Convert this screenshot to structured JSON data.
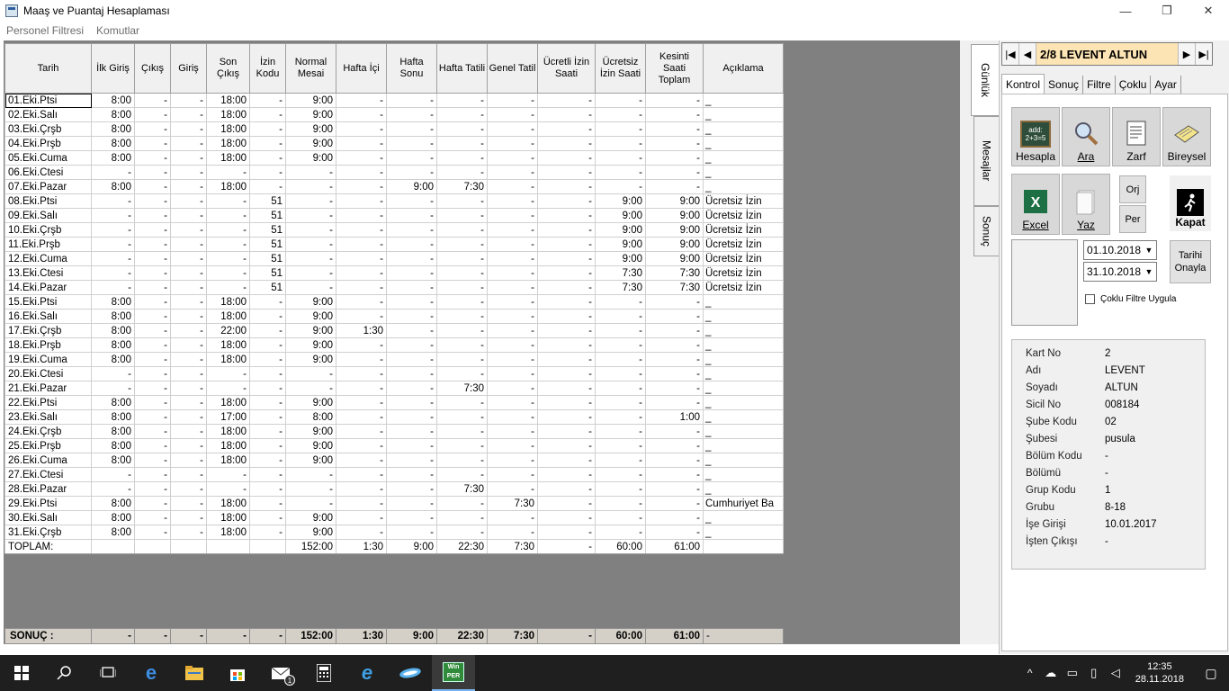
{
  "window": {
    "title": "Maaş ve Puantaj Hesaplaması",
    "minimize": "—",
    "restore": "❐",
    "close": "✕"
  },
  "menu": [
    "Personel Filtresi",
    "Komutlar"
  ],
  "grid": {
    "headers": [
      "Tarih",
      "İlk Giriş",
      "Çıkış",
      "Giriş",
      "Son Çıkış",
      "İzin Kodu",
      "Normal Mesai",
      "Hafta İçi",
      "Hafta Sonu",
      "Hafta Tatili",
      "Genel Tatil",
      "Ücretli İzin Saati",
      "Ücretsiz İzin Saati",
      "Kesinti Saati Toplam",
      "Açıklama"
    ],
    "rows": [
      [
        "01.Eki.Ptsi",
        "8:00",
        "-",
        "-",
        "18:00",
        "-",
        "9:00",
        "-",
        "-",
        "-",
        "-",
        "-",
        "-",
        "-",
        "_"
      ],
      [
        "02.Eki.Salı",
        "8:00",
        "-",
        "-",
        "18:00",
        "-",
        "9:00",
        "-",
        "-",
        "-",
        "-",
        "-",
        "-",
        "-",
        "_"
      ],
      [
        "03.Eki.Çrşb",
        "8:00",
        "-",
        "-",
        "18:00",
        "-",
        "9:00",
        "-",
        "-",
        "-",
        "-",
        "-",
        "-",
        "-",
        "_"
      ],
      [
        "04.Eki.Prşb",
        "8:00",
        "-",
        "-",
        "18:00",
        "-",
        "9:00",
        "-",
        "-",
        "-",
        "-",
        "-",
        "-",
        "-",
        "_"
      ],
      [
        "05.Eki.Cuma",
        "8:00",
        "-",
        "-",
        "18:00",
        "-",
        "9:00",
        "-",
        "-",
        "-",
        "-",
        "-",
        "-",
        "-",
        "_"
      ],
      [
        "06.Eki.Ctesi",
        "-",
        "-",
        "-",
        "-",
        "-",
        "-",
        "-",
        "-",
        "-",
        "-",
        "-",
        "-",
        "-",
        "_"
      ],
      [
        "07.Eki.Pazar",
        "8:00",
        "-",
        "-",
        "18:00",
        "-",
        "-",
        "-",
        "9:00",
        "7:30",
        "-",
        "-",
        "-",
        "-",
        "_"
      ],
      [
        "08.Eki.Ptsi",
        "-",
        "-",
        "-",
        "-",
        "51",
        "-",
        "-",
        "-",
        "-",
        "-",
        "-",
        "9:00",
        "9:00",
        "Ücretsiz İzin"
      ],
      [
        "09.Eki.Salı",
        "-",
        "-",
        "-",
        "-",
        "51",
        "-",
        "-",
        "-",
        "-",
        "-",
        "-",
        "9:00",
        "9:00",
        "Ücretsiz İzin"
      ],
      [
        "10.Eki.Çrşb",
        "-",
        "-",
        "-",
        "-",
        "51",
        "-",
        "-",
        "-",
        "-",
        "-",
        "-",
        "9:00",
        "9:00",
        "Ücretsiz İzin"
      ],
      [
        "11.Eki.Prşb",
        "-",
        "-",
        "-",
        "-",
        "51",
        "-",
        "-",
        "-",
        "-",
        "-",
        "-",
        "9:00",
        "9:00",
        "Ücretsiz İzin"
      ],
      [
        "12.Eki.Cuma",
        "-",
        "-",
        "-",
        "-",
        "51",
        "-",
        "-",
        "-",
        "-",
        "-",
        "-",
        "9:00",
        "9:00",
        "Ücretsiz İzin"
      ],
      [
        "13.Eki.Ctesi",
        "-",
        "-",
        "-",
        "-",
        "51",
        "-",
        "-",
        "-",
        "-",
        "-",
        "-",
        "7:30",
        "7:30",
        "Ücretsiz İzin"
      ],
      [
        "14.Eki.Pazar",
        "-",
        "-",
        "-",
        "-",
        "51",
        "-",
        "-",
        "-",
        "-",
        "-",
        "-",
        "7:30",
        "7:30",
        "Ücretsiz İzin"
      ],
      [
        "15.Eki.Ptsi",
        "8:00",
        "-",
        "-",
        "18:00",
        "-",
        "9:00",
        "-",
        "-",
        "-",
        "-",
        "-",
        "-",
        "-",
        "_"
      ],
      [
        "16.Eki.Salı",
        "8:00",
        "-",
        "-",
        "18:00",
        "-",
        "9:00",
        "-",
        "-",
        "-",
        "-",
        "-",
        "-",
        "-",
        "_"
      ],
      [
        "17.Eki.Çrşb",
        "8:00",
        "-",
        "-",
        "22:00",
        "-",
        "9:00",
        "1:30",
        "-",
        "-",
        "-",
        "-",
        "-",
        "-",
        "_"
      ],
      [
        "18.Eki.Prşb",
        "8:00",
        "-",
        "-",
        "18:00",
        "-",
        "9:00",
        "-",
        "-",
        "-",
        "-",
        "-",
        "-",
        "-",
        "_"
      ],
      [
        "19.Eki.Cuma",
        "8:00",
        "-",
        "-",
        "18:00",
        "-",
        "9:00",
        "-",
        "-",
        "-",
        "-",
        "-",
        "-",
        "-",
        "_"
      ],
      [
        "20.Eki.Ctesi",
        "-",
        "-",
        "-",
        "-",
        "-",
        "-",
        "-",
        "-",
        "-",
        "-",
        "-",
        "-",
        "-",
        "_"
      ],
      [
        "21.Eki.Pazar",
        "-",
        "-",
        "-",
        "-",
        "-",
        "-",
        "-",
        "-",
        "7:30",
        "-",
        "-",
        "-",
        "-",
        "_"
      ],
      [
        "22.Eki.Ptsi",
        "8:00",
        "-",
        "-",
        "18:00",
        "-",
        "9:00",
        "-",
        "-",
        "-",
        "-",
        "-",
        "-",
        "-",
        "_"
      ],
      [
        "23.Eki.Salı",
        "8:00",
        "-",
        "-",
        "17:00",
        "-",
        "8:00",
        "-",
        "-",
        "-",
        "-",
        "-",
        "-",
        "1:00",
        "_"
      ],
      [
        "24.Eki.Çrşb",
        "8:00",
        "-",
        "-",
        "18:00",
        "-",
        "9:00",
        "-",
        "-",
        "-",
        "-",
        "-",
        "-",
        "-",
        "_"
      ],
      [
        "25.Eki.Prşb",
        "8:00",
        "-",
        "-",
        "18:00",
        "-",
        "9:00",
        "-",
        "-",
        "-",
        "-",
        "-",
        "-",
        "-",
        "_"
      ],
      [
        "26.Eki.Cuma",
        "8:00",
        "-",
        "-",
        "18:00",
        "-",
        "9:00",
        "-",
        "-",
        "-",
        "-",
        "-",
        "-",
        "-",
        "_"
      ],
      [
        "27.Eki.Ctesi",
        "-",
        "-",
        "-",
        "-",
        "-",
        "-",
        "-",
        "-",
        "-",
        "-",
        "-",
        "-",
        "-",
        "_"
      ],
      [
        "28.Eki.Pazar",
        "-",
        "-",
        "-",
        "-",
        "-",
        "-",
        "-",
        "-",
        "7:30",
        "-",
        "-",
        "-",
        "-",
        "_"
      ],
      [
        "29.Eki.Ptsi",
        "8:00",
        "-",
        "-",
        "18:00",
        "-",
        "-",
        "-",
        "-",
        "-",
        "7:30",
        "-",
        "-",
        "-",
        "Cumhuriyet Ba"
      ],
      [
        "30.Eki.Salı",
        "8:00",
        "-",
        "-",
        "18:00",
        "-",
        "9:00",
        "-",
        "-",
        "-",
        "-",
        "-",
        "-",
        "-",
        "_"
      ],
      [
        "31.Eki.Çrşb",
        "8:00",
        "-",
        "-",
        "18:00",
        "-",
        "9:00",
        "-",
        "-",
        "-",
        "-",
        "-",
        "-",
        "-",
        "_"
      ]
    ],
    "total": [
      "TOPLAM:",
      "",
      "",
      "",
      "",
      "",
      "152:00",
      "1:30",
      "9:00",
      "22:30",
      "7:30",
      "-",
      "60:00",
      "61:00",
      ""
    ]
  },
  "summary": [
    "SONUÇ :",
    "-",
    "-",
    "-",
    "-",
    "-",
    "152:00",
    "1:30",
    "9:00",
    "22:30",
    "7:30",
    "-",
    "60:00",
    "61:00",
    "-"
  ],
  "vtabs": [
    "Günlük",
    "Mesajlar",
    "Sonuç"
  ],
  "nav": {
    "first": "|◀",
    "prev": "◀",
    "name": "2/8 LEVENT ALTUN",
    "next": "▶",
    "last": "▶|"
  },
  "tabs": [
    "Kontrol",
    "Sonuç",
    "Filtre",
    "Çoklu",
    "Ayar"
  ],
  "buttons": {
    "hesapla": "Hesapla",
    "ara": "Ara",
    "zarf": "Zarf",
    "bireysel": "Bireysel",
    "excel": "Excel",
    "yaz": "Yaz",
    "orj": "Orj",
    "per": "Per",
    "kapat": "Kapat",
    "hesapla_icon_text": "add: 2+3=5"
  },
  "dates": {
    "start": "01.10.2018",
    "end": "31.10.2018",
    "confirm_line1": "Tarihi",
    "confirm_line2": "Onayla"
  },
  "multi_filter": "Çoklu Filtre Uygula",
  "info": [
    {
      "k": "Kart No",
      "v": "2"
    },
    {
      "k": "Adı",
      "v": "LEVENT"
    },
    {
      "k": "Soyadı",
      "v": "ALTUN"
    },
    {
      "k": "Sicil No",
      "v": "008184"
    },
    {
      "k": "Şube Kodu",
      "v": "02"
    },
    {
      "k": "Şubesi",
      "v": "pusula"
    },
    {
      "k": "Bölüm Kodu",
      "v": "-"
    },
    {
      "k": "Bölümü",
      "v": " -"
    },
    {
      "k": "Grup Kodu",
      "v": "1"
    },
    {
      "k": "Grubu",
      "v": "8-18"
    },
    {
      "k": "İşe Girişi",
      "v": "10.01.2017"
    },
    {
      "k": "İşten Çıkışı",
      "v": "-"
    }
  ],
  "taskbar": {
    "time": "12:35",
    "date": "28.11.2018",
    "badge": "1",
    "winper": "Win PER"
  }
}
